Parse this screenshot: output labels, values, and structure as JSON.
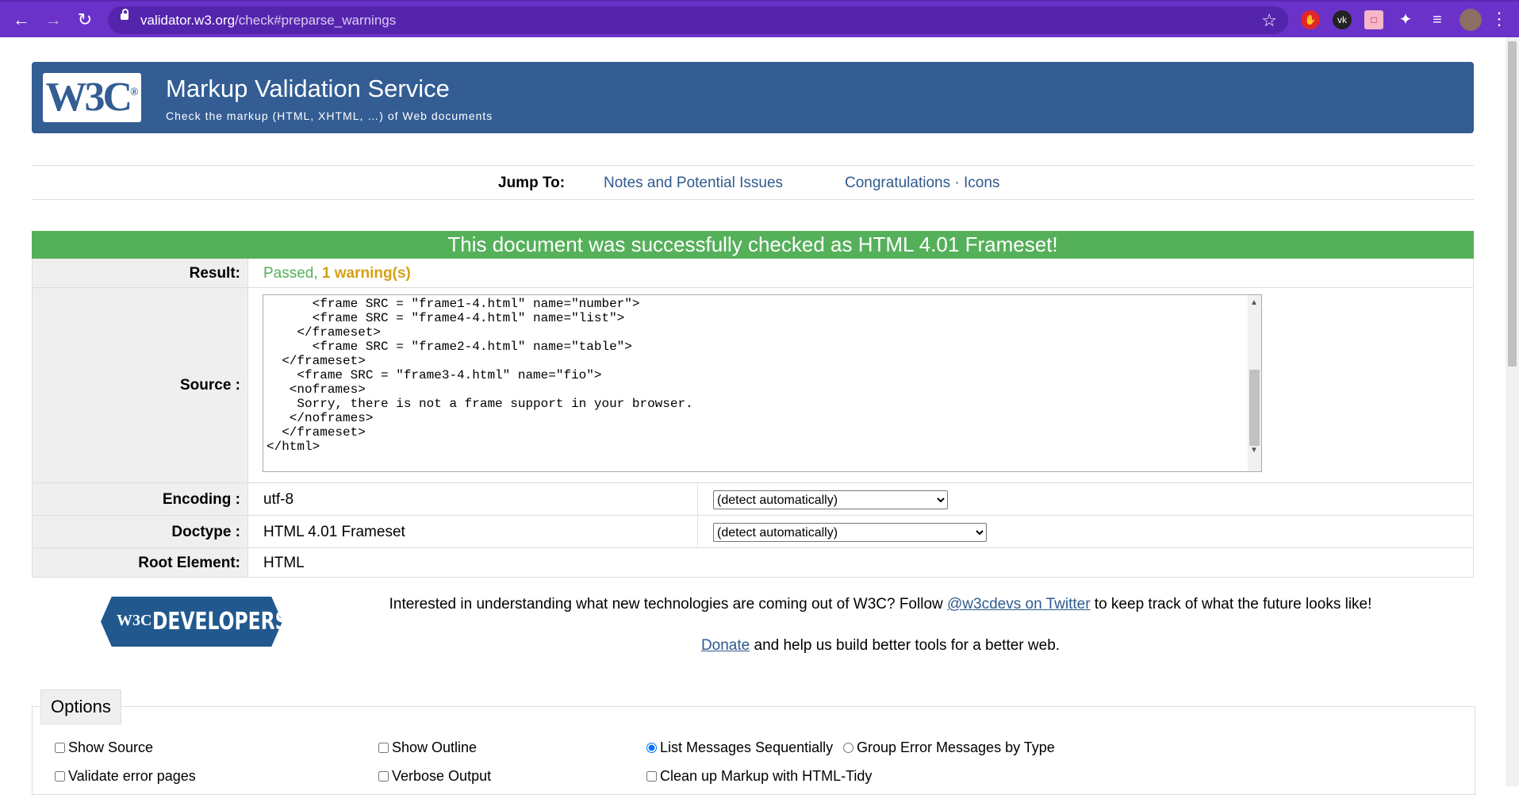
{
  "browser": {
    "url_host": "validator.w3.org",
    "url_path": "/check#preparse_warnings"
  },
  "header": {
    "logo_text": "W3C",
    "logo_mark": "®",
    "title": "Markup Validation Service",
    "subtitle": "Check the markup (HTML, XHTML, …) of Web documents"
  },
  "jump": {
    "label": "Jump To:",
    "links": [
      "Notes and Potential Issues",
      "Congratulations · Icons"
    ]
  },
  "result_banner": "This document was successfully checked as HTML 4.01 Frameset!",
  "table": {
    "result_label": "Result:",
    "result_passed": "Passed, ",
    "result_warnings": "1 warning(s)",
    "source_label": "Source :",
    "source_code": "      <frame SRC = \"frame1-4.html\" name=\"number\">\n      <frame SRC = \"frame4-4.html\" name=\"list\">\n    </frameset>\n      <frame SRC = \"frame2-4.html\" name=\"table\">\n  </frameset>\n    <frame SRC = \"frame3-4.html\" name=\"fio\">\n   <noframes>\n    Sorry, there is not a frame support in your browser.\n   </noframes>\n  </frameset>\n</html>",
    "encoding_label": "Encoding :",
    "encoding_value": "utf-8",
    "encoding_select": "(detect automatically)",
    "doctype_label": "Doctype :",
    "doctype_value": "HTML 4.01 Frameset",
    "doctype_select": "(detect automatically)",
    "root_label": "Root Element:",
    "root_value": "HTML"
  },
  "developers": {
    "logo_w3c": "W3C",
    "logo_word": "DEVELOPERS",
    "line1_before": "Interested in understanding what new technologies are coming out of W3C? Follow ",
    "line1_link": "@w3cdevs on Twitter",
    "line1_after": " to keep track of what the future looks like!",
    "line2_link": "Donate",
    "line2_after": " and help us build better tools for a better web."
  },
  "options": {
    "legend": "Options",
    "show_source": "Show Source",
    "show_outline": "Show Outline",
    "list_sequential": "List Messages Sequentially",
    "group_by_type": "Group Error Messages by Type",
    "validate_error_pages": "Validate error pages",
    "verbose_output": "Verbose Output",
    "clean_up_markup": "Clean up Markup with HTML-Tidy"
  },
  "colors": {
    "browser_frame": "#6a32c9",
    "banner": "#335d93",
    "success": "#55b05a",
    "warning": "#d4a017",
    "passed": "#55b05a",
    "link": "#2f5a8e"
  }
}
